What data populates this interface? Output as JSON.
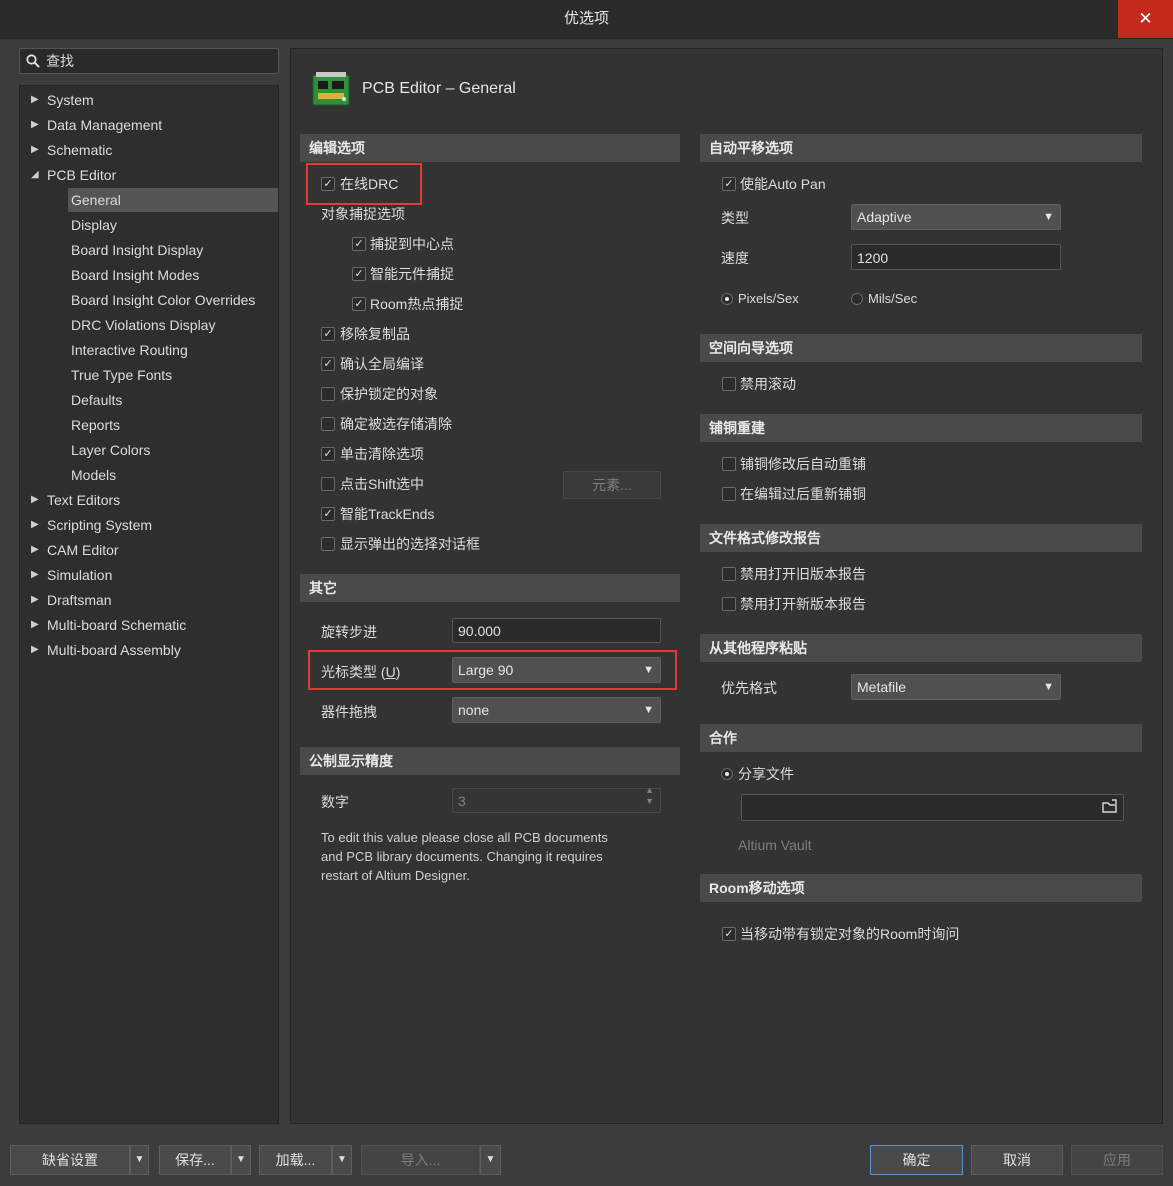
{
  "window": {
    "title": "优选项",
    "close_icon": "close-icon"
  },
  "search": {
    "placeholder": "查找",
    "icon": "search-icon"
  },
  "tree": {
    "items": [
      {
        "label": "System",
        "expandable": true
      },
      {
        "label": "Data Management",
        "expandable": true
      },
      {
        "label": "Schematic",
        "expandable": true
      },
      {
        "label": "PCB Editor",
        "expandable": true,
        "expanded": true
      },
      {
        "label": "General",
        "selected": true
      },
      {
        "label": "Display"
      },
      {
        "label": "Board Insight Display"
      },
      {
        "label": "Board Insight Modes"
      },
      {
        "label": "Board Insight Color Overrides"
      },
      {
        "label": "DRC Violations Display"
      },
      {
        "label": "Interactive Routing"
      },
      {
        "label": "True Type Fonts"
      },
      {
        "label": "Defaults"
      },
      {
        "label": "Reports"
      },
      {
        "label": "Layer Colors"
      },
      {
        "label": "Models"
      },
      {
        "label": "Text Editors",
        "expandable": true
      },
      {
        "label": "Scripting System",
        "expandable": true
      },
      {
        "label": "CAM Editor",
        "expandable": true
      },
      {
        "label": "Simulation",
        "expandable": true
      },
      {
        "label": "Draftsman",
        "expandable": true
      },
      {
        "label": "Multi-board Schematic",
        "expandable": true
      },
      {
        "label": "Multi-board Assembly",
        "expandable": true
      }
    ]
  },
  "panel": {
    "title": "PCB Editor – General",
    "icon": "pcb-board-icon"
  },
  "edit_options": {
    "header": "编辑选项",
    "online_drc": {
      "label": "在线DRC",
      "checked": true
    },
    "snap_header": "对象捕捉选项",
    "snap_center": {
      "label": "捕捉到中心点",
      "checked": true
    },
    "smart_component": {
      "label": "智能元件捕捉",
      "checked": true
    },
    "room_hotspot": {
      "label": "Room热点捕捉",
      "checked": true
    },
    "remove_duplicates": {
      "label": "移除复制品",
      "checked": true
    },
    "confirm_global": {
      "label": "确认全局编译",
      "checked": true
    },
    "protect_locked": {
      "label": "保护锁定的对象",
      "checked": false
    },
    "confirm_clear": {
      "label": "确定被选存储清除",
      "checked": false
    },
    "click_clear": {
      "label": "单击清除选项",
      "checked": true
    },
    "shift_select": {
      "label": "点击Shift选中",
      "checked": false
    },
    "primitives_button": "元素...",
    "smart_track_ends": {
      "label": "智能TrackEnds",
      "checked": true
    },
    "show_popup": {
      "label": "显示弹出的选择对话框",
      "checked": false
    }
  },
  "other": {
    "header": "其它",
    "rotation_label": "旋转步进",
    "rotation_value": "90.000",
    "cursor_label_pre": "光标类型 (",
    "cursor_label_key": "U",
    "cursor_label_post": ")",
    "cursor_value": "Large 90",
    "drag_label": "器件拖拽",
    "drag_value": "none"
  },
  "metric": {
    "header": "公制显示精度",
    "digits_label": "数字",
    "digits_value": "3",
    "note_line1": "To edit this value please close all PCB documents",
    "note_line2": "and PCB library documents. Changing it requires",
    "note_line3": "restart of Altium Designer."
  },
  "autopan": {
    "header": "自动平移选项",
    "enable": {
      "label": "使能Auto Pan",
      "checked": true
    },
    "type_label": "类型",
    "type_value": "Adaptive",
    "speed_label": "速度",
    "speed_value": "1200",
    "pixels": {
      "label": "Pixels/Sex",
      "selected": true
    },
    "mils": {
      "label": "Mils/Sec",
      "selected": false
    }
  },
  "space_nav": {
    "header": "空间向导选项",
    "disable_roll": {
      "label": "禁用滚动",
      "checked": false
    }
  },
  "polygon": {
    "header": "铺铜重建",
    "auto_repour": {
      "label": "铺铜修改后自动重铺",
      "checked": false
    },
    "repour_after_edit": {
      "label": "在编辑过后重新铺铜",
      "checked": false
    }
  },
  "file_report": {
    "header": "文件格式修改报告",
    "old_version": {
      "label": "禁用打开旧版本报告",
      "checked": false
    },
    "new_version": {
      "label": "禁用打开新版本报告",
      "checked": false
    }
  },
  "paste": {
    "header": "从其他程序粘贴",
    "format_label": "优先格式",
    "format_value": "Metafile"
  },
  "collab": {
    "header": "合作",
    "shared": {
      "label": "分享文件",
      "selected": true
    },
    "path_value": "",
    "vault": {
      "label": "Altium Vault",
      "selected": false
    }
  },
  "room_move": {
    "header": "Room移动选项",
    "ask_locked": {
      "label": "当移动带有锁定对象的Room时询问",
      "checked": true
    }
  },
  "footer": {
    "defaults": "缺省设置",
    "save": "保存...",
    "load": "加载...",
    "import": "导入...",
    "ok": "确定",
    "cancel": "取消",
    "apply": "应用"
  }
}
